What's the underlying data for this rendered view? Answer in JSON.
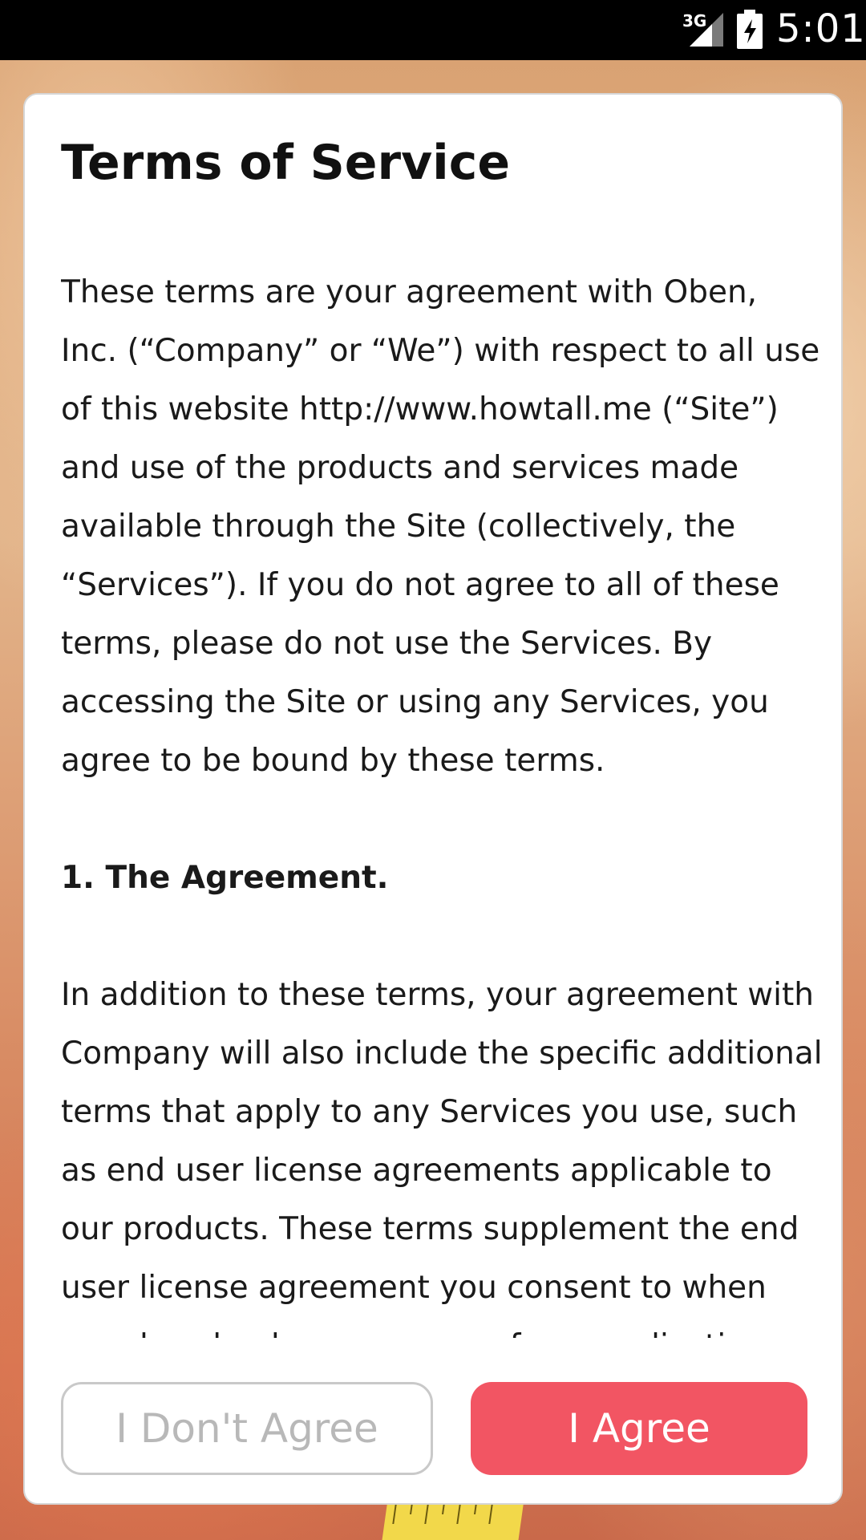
{
  "status_bar": {
    "network": "3G",
    "time": "5:01"
  },
  "dialog": {
    "title": "Terms of Service",
    "paragraphs": [
      "These terms are your agreement with Oben, Inc. (“Company” or “We”) with respect to all use of this website http://www.howtall.me (“Site”) and use of the products and services made available through the Site (collectively, the “Services”). If you do not agree to all of these terms, please do not use the Services. By accessing the Site or using any Services, you agree to be bound by these terms.",
      "1. The Agreement.",
      "In addition to these terms, your agreement with Company will also include the specific additional terms that apply to any Services you use, such as end user license agreements applicable to our products. These terms supplement the end user license agreement you consent to when you download one or more of our applications from"
    ],
    "buttons": {
      "disagree": "I Don't Agree",
      "agree": "I Agree"
    }
  },
  "colors": {
    "agree_button": "#f25563",
    "disagree_text": "#b8b8b8",
    "status_bar": "#000000"
  },
  "icons": [
    "signal-icon",
    "battery-charging-icon"
  ]
}
